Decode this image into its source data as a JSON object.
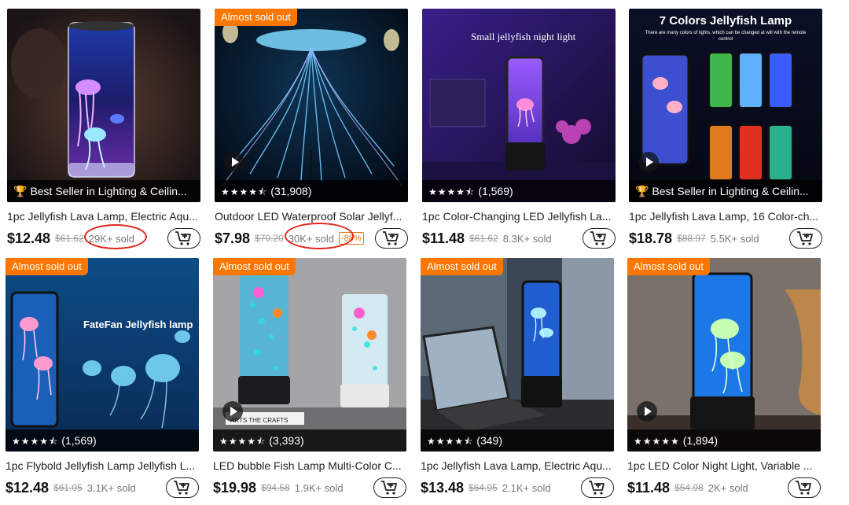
{
  "products": [
    {
      "badge": "",
      "image_text": "",
      "bottom_type": "bestseller",
      "bottom_text": "Best Seller in Lighting & Ceilin...",
      "stars": "",
      "rating_count": "",
      "has_play": false,
      "title": "1pc Jellyfish Lava Lamp, Electric Aqu...",
      "price": "$12.48",
      "original_price": "$61.62",
      "sold": "29K+ sold",
      "discount": ""
    },
    {
      "badge": "Almost sold out",
      "image_text": "",
      "bottom_type": "rating",
      "bottom_text": "",
      "stars": "★★★★⯪",
      "rating_count": "(31,908)",
      "has_play": true,
      "title": "Outdoor LED Waterproof Solar Jellyf...",
      "price": "$7.98",
      "original_price": "$70.20",
      "sold": "30K+ sold",
      "discount": "-88%"
    },
    {
      "badge": "",
      "image_text": "Small jellyfish night light",
      "bottom_type": "rating",
      "bottom_text": "",
      "stars": "★★★★⯪",
      "rating_count": "(1,569)",
      "has_play": false,
      "title": "1pc Color-Changing LED Jellyfish La...",
      "price": "$11.48",
      "original_price": "$61.62",
      "sold": "8.3K+ sold",
      "discount": ""
    },
    {
      "badge": "",
      "image_text": "7 Colors Jellyfish Lamp",
      "image_subtext": "There are many colors of lights, which can be changed at will with the remote control",
      "bottom_type": "bestseller",
      "bottom_text": "Best Seller in Lighting & Ceilin...",
      "stars": "",
      "rating_count": "",
      "has_play": true,
      "title": "1pc Jellyfish Lava Lamp, 16 Color-ch...",
      "price": "$18.78",
      "original_price": "$88.97",
      "sold": "5.5K+ sold",
      "discount": ""
    },
    {
      "badge": "Almost sold out",
      "image_text": "FateFan Jellyfish lamp",
      "bottom_type": "rating",
      "bottom_text": "",
      "stars": "★★★★⯪",
      "rating_count": "(1,569)",
      "has_play": false,
      "title": "1pc Flybold Jellyfish Lamp Jellyfish L...",
      "price": "$12.48",
      "original_price": "$61.05",
      "sold": "3.1K+ sold",
      "discount": ""
    },
    {
      "badge": "Almost sold out",
      "image_text": "ARTS THE CRAFTS",
      "bottom_type": "rating",
      "bottom_text": "",
      "stars": "★★★★⯪",
      "rating_count": "(3,393)",
      "has_play": true,
      "title": "LED bubble Fish Lamp Multi-Color C...",
      "price": "$19.98",
      "original_price": "$94.58",
      "sold": "1.9K+ sold",
      "discount": ""
    },
    {
      "badge": "Almost sold out",
      "image_text": "",
      "bottom_type": "rating",
      "bottom_text": "",
      "stars": "★★★★⯪",
      "rating_count": "(349)",
      "has_play": false,
      "title": "1pc Jellyfish Lava Lamp, Electric Aqu...",
      "price": "$13.48",
      "original_price": "$64.95",
      "sold": "2.1K+ sold",
      "discount": ""
    },
    {
      "badge": "Almost sold out",
      "image_text": "",
      "bottom_type": "rating",
      "bottom_text": "",
      "stars": "★★★★★",
      "rating_count": "(1,894)",
      "has_play": true,
      "title": "1pc LED Color Night Light, Variable ...",
      "price": "$11.48",
      "original_price": "$54.98",
      "sold": "2K+ sold",
      "discount": ""
    }
  ],
  "icons": {
    "trophy": "trophy-icon",
    "cart": "add-to-cart-icon",
    "play": "play-icon"
  },
  "colors": {
    "badge": "#fb7701",
    "annotation_circle": "#e0251f"
  }
}
